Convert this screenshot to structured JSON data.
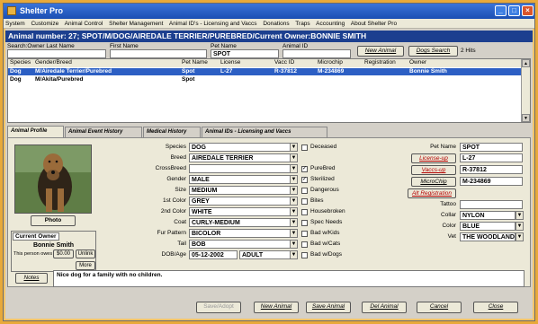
{
  "window": {
    "title": "Shelter Pro"
  },
  "menu": [
    "System",
    "Customize",
    "Animal Control",
    "Shelter Management",
    "Animal ID's - Licensing and Vaccs",
    "Donations",
    "Traps",
    "Accounting",
    "About Shelter Pro"
  ],
  "header": "Animal number: 27; SPOT/M/DOG/AIREDALE TERRIER/PUREBRED/Current Owner:BONNIE SMITH",
  "search": {
    "last_name_label": "Search:Owner Last Name",
    "first_name_label": "First Name",
    "pet_name_label": "Pet Name",
    "pet_name_value": "SPOT",
    "animal_id_label": "Animal ID",
    "new_animal_button": "New Animal",
    "dogs_search_button": "Dogs Search",
    "hits_text": "2 Hits"
  },
  "grid": {
    "columns": [
      "Species",
      "Gender/Breed",
      "Pet Name",
      "License",
      "Vacc ID",
      "Microchip",
      "Registration",
      "Owner"
    ],
    "rows": [
      [
        "Dog",
        "M/Airedale Terrier/Purebred",
        "Spot",
        "L-27",
        "R-37812",
        "M-234869",
        "",
        "Bonnie Smith"
      ],
      [
        "Dog",
        "M/Akita/Purebred",
        "Spot",
        "",
        "",
        "",
        "",
        ""
      ]
    ]
  },
  "tabs": [
    "Animal Profile",
    "Animal Event History",
    "Medical History",
    "Animal IDs - Licensing and Vaccs"
  ],
  "photo_button": "Photo",
  "owner": {
    "title": "Current Owner",
    "name": "Bonnie Smith",
    "owes_text": "This person owes us",
    "owes_amount": "$0.00",
    "more_button": "More"
  },
  "fields": {
    "species": {
      "label": "Species",
      "value": "DOG"
    },
    "breed": {
      "label": "Breed",
      "value": "AIREDALE TERRIER"
    },
    "crossbreed": {
      "label": "CrossBreed",
      "value": ""
    },
    "gender": {
      "label": "Gender",
      "value": "MALE"
    },
    "size": {
      "label": "Size",
      "value": "MEDIUM"
    },
    "color1": {
      "label": "1st Color",
      "value": "GREY"
    },
    "color2": {
      "label": "2nd Color",
      "value": "WHITE"
    },
    "coat": {
      "label": "Coat",
      "value": "CURLY-MEDIUM"
    },
    "fur": {
      "label": "Fur Pattern",
      "value": "BICOLOR"
    },
    "tail": {
      "label": "Tail",
      "value": "BOB"
    },
    "dob": {
      "label": "DOB/Age",
      "value": "05-12-2002",
      "age": "ADULT"
    }
  },
  "checks": [
    {
      "label": "Deceased",
      "checked": false
    },
    {
      "label": "PureBred",
      "checked": true
    },
    {
      "label": "Sterilized",
      "checked": true
    },
    {
      "label": "Dangerous",
      "checked": false
    },
    {
      "label": "Bites",
      "checked": false
    },
    {
      "label": "Housebroken",
      "checked": false
    },
    {
      "label": "Spec Needs",
      "checked": false
    },
    {
      "label": "Bad w/Kids",
      "checked": false
    },
    {
      "label": "Bad w/Cats",
      "checked": false
    },
    {
      "label": "Bad w/Dogs",
      "checked": false
    }
  ],
  "right": {
    "pet_name_label": "Pet Name",
    "pet_name_value": "SPOT",
    "license_button": "License-up",
    "license_value": "L-27",
    "vaccs_button": "Vaccs-up",
    "vaccs_value": "R-37812",
    "microchip_button": "MicroChip",
    "microchip_value": "M-234869",
    "registration_button": "Alt Registration",
    "tattoo_label": "Tattoo",
    "collar_label": "Collar",
    "collar_value": "NYLON",
    "color_label": "Color",
    "color_value": "BLUE",
    "vet_label": "Vet",
    "vet_value": "THE WOODLANDS VE"
  },
  "notes": {
    "button": "Notes",
    "value": "Nice dog for a family with no children."
  },
  "bottom": {
    "save_adopt": "Save/Adopt",
    "new_animal": "New Animal",
    "save_animal": "Save Animal",
    "del_animal": "Del Animal",
    "cancel": "Cancel",
    "close": "Close"
  }
}
